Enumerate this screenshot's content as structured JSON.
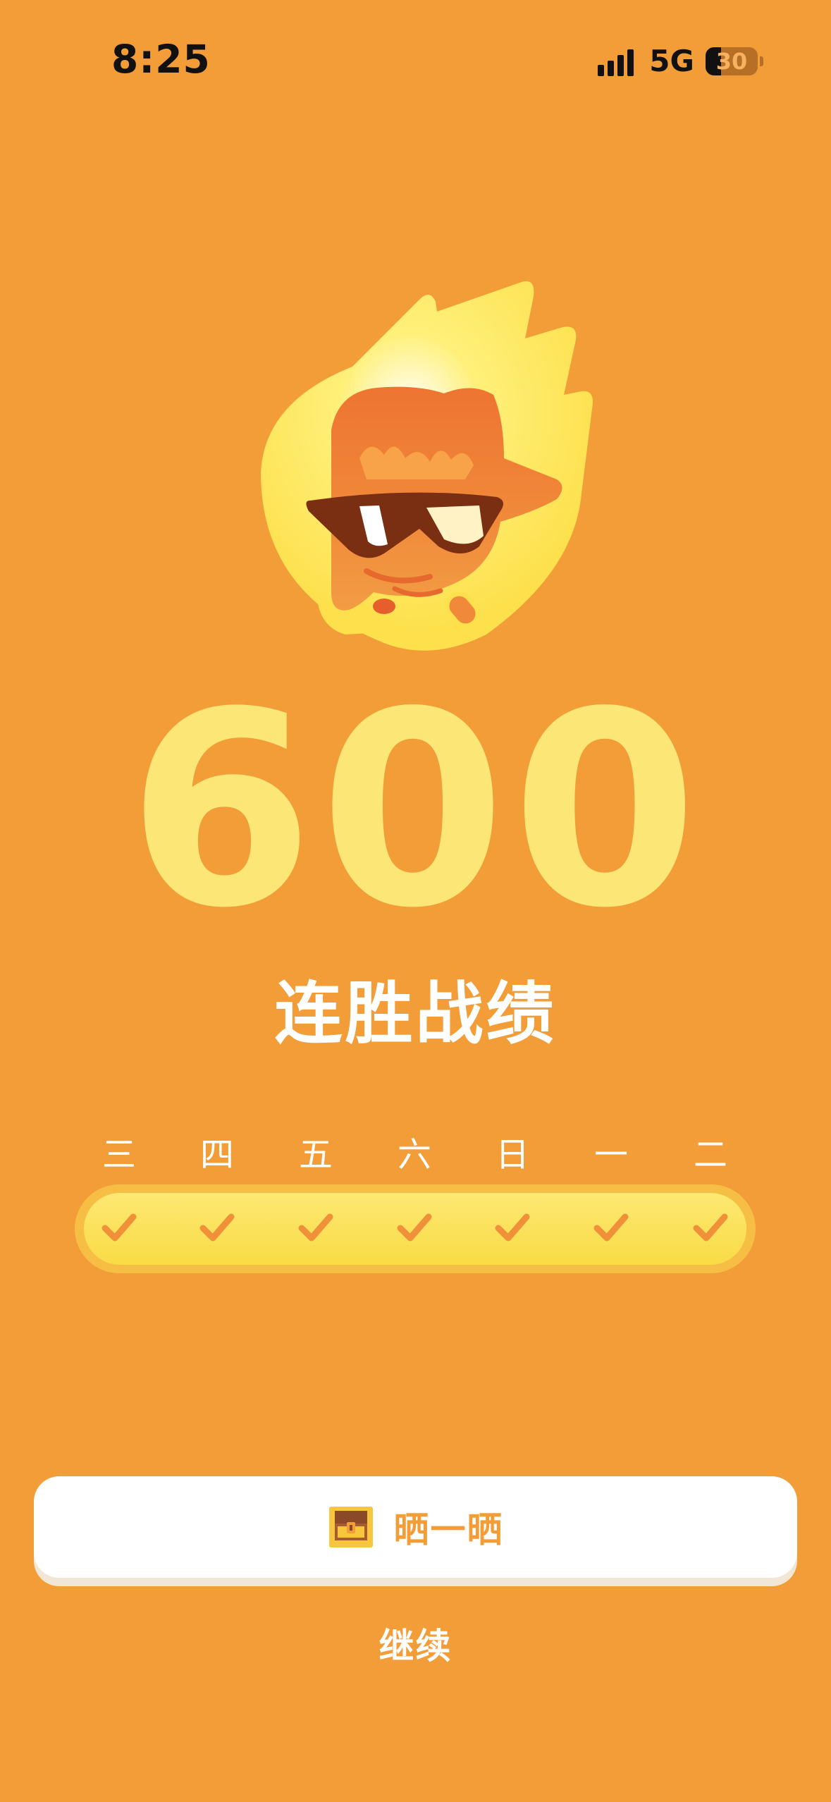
{
  "status_bar": {
    "time": "8:25",
    "network": "5G",
    "battery": "30"
  },
  "streak": {
    "count": "600",
    "label": "连胜战绩"
  },
  "week": {
    "days": [
      "三",
      "四",
      "五",
      "六",
      "日",
      "一",
      "二"
    ],
    "completed": [
      true,
      true,
      true,
      true,
      true,
      true,
      true
    ]
  },
  "actions": {
    "share_label": "晒一晒",
    "continue_label": "继续"
  },
  "icons": {
    "mascot": "flame-mascot-sunglasses-icon",
    "check": "checkmark-icon",
    "share": "treasure-chest-icon"
  },
  "colors": {
    "background": "#F29D38",
    "number": "#FBE676",
    "check": "#F0913A",
    "track": "#F7BE45",
    "track_fill": "#FDE873"
  }
}
